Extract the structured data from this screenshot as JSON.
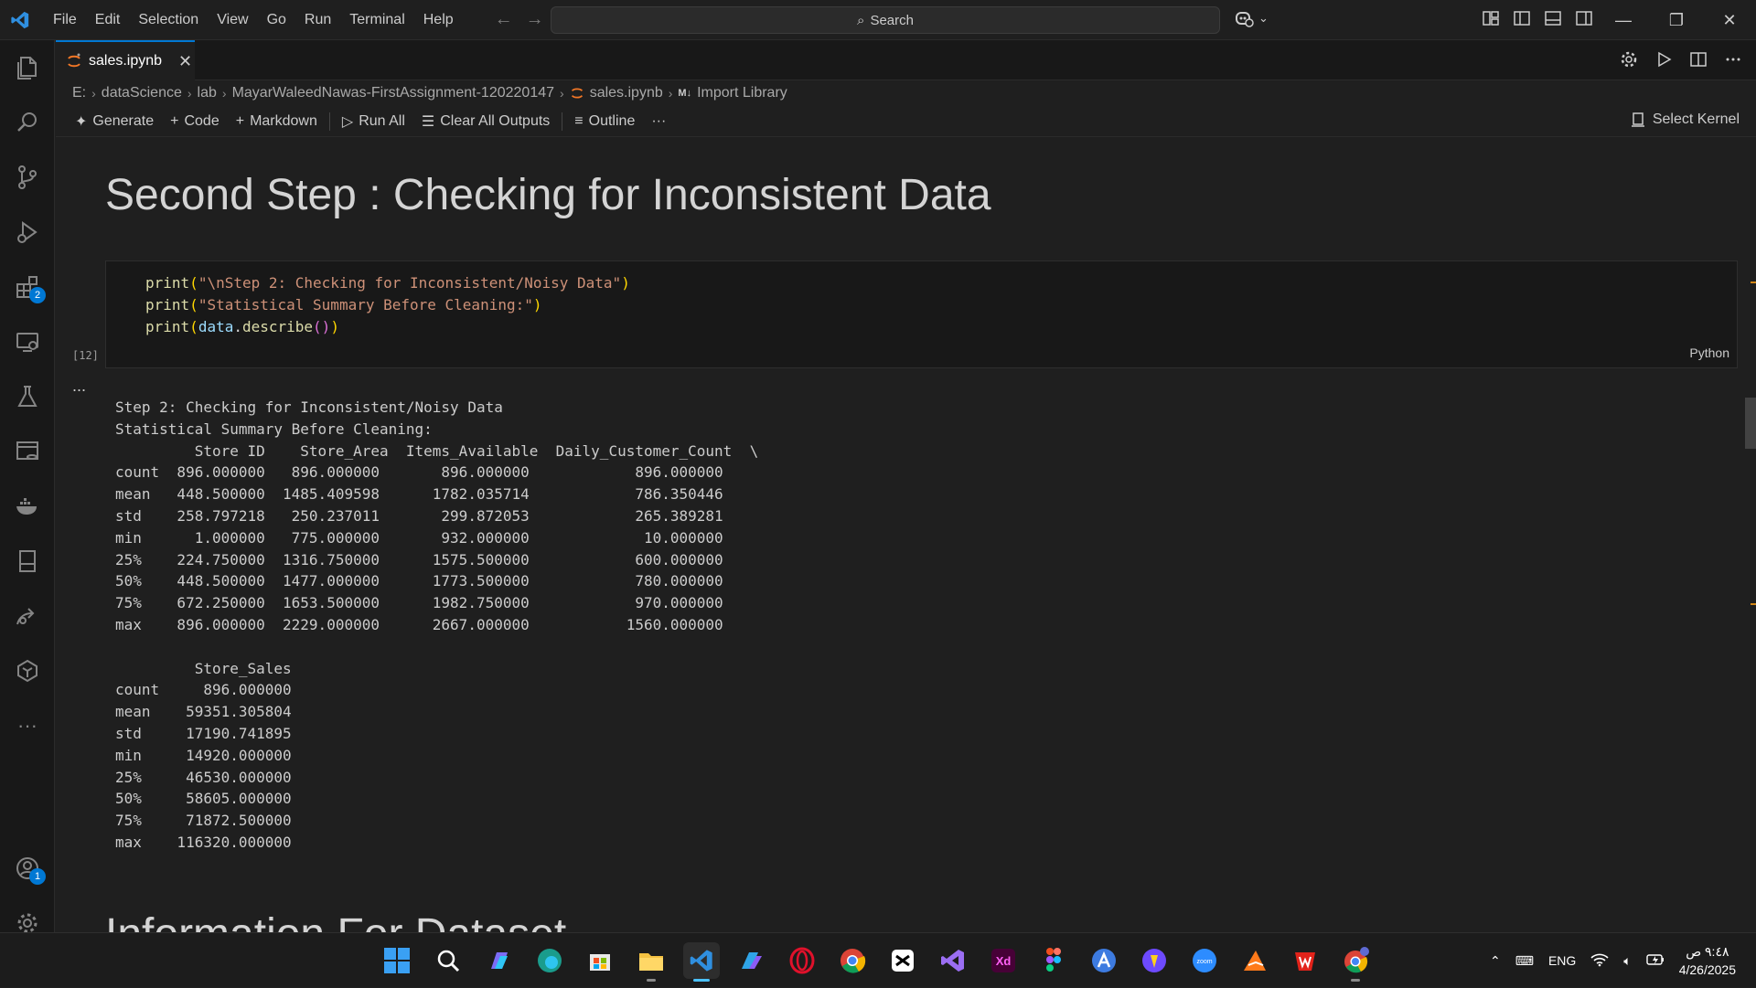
{
  "titlebar": {
    "menu": [
      "File",
      "Edit",
      "Selection",
      "View",
      "Go",
      "Run",
      "Terminal",
      "Help"
    ],
    "search_label": "Search"
  },
  "activity_badges": {
    "extensions": "2",
    "accounts": "1"
  },
  "tab": {
    "filename": "sales.ipynb"
  },
  "breadcrumb": [
    "E:",
    "dataScience",
    "lab",
    "MayarWaleedNawas-FirstAssignment-120220147",
    "sales.ipynb",
    "Import Library"
  ],
  "toolbar": {
    "generate": "Generate",
    "code": "Code",
    "markdown": "Markdown",
    "run_all": "Run All",
    "clear_outputs": "Clear All Outputs",
    "outline": "Outline",
    "more": "···",
    "kernel": "Select Kernel"
  },
  "notebook": {
    "heading": "Second Step : Checking for Inconsistent Data",
    "code": {
      "line1_fn": "print",
      "line1_str": "\"\\nStep 2: Checking for Inconsistent/Noisy Data\"",
      "line2_fn": "print",
      "line2_str": "\"Statistical Summary Before Cleaning:\"",
      "line3_fn": "print",
      "line3_var": "data",
      "line3_method": "describe",
      "exec_count": "[12]",
      "language": "Python"
    },
    "output_dots": "...",
    "output_text": "Step 2: Checking for Inconsistent/Noisy Data\nStatistical Summary Before Cleaning:\n         Store ID    Store_Area  Items_Available  Daily_Customer_Count  \\\ncount  896.000000   896.000000       896.000000            896.000000   \nmean   448.500000  1485.409598      1782.035714            786.350446   \nstd    258.797218   250.237011       299.872053            265.389281   \nmin      1.000000   775.000000       932.000000             10.000000   \n25%    224.750000  1316.750000      1575.500000            600.000000   \n50%    448.500000  1477.000000      1773.500000            780.000000   \n75%    672.250000  1653.500000      1982.750000            970.000000   \nmax    896.000000  2229.000000      2667.000000           1560.000000   \n\n         Store_Sales  \ncount     896.000000  \nmean    59351.305804  \nstd     17190.741895  \nmin     14920.000000  \n25%     46530.000000  \n50%     58605.000000  \n75%     71872.500000  \nmax    116320.000000  ",
    "next_heading": "Information For Dataset"
  },
  "taskbar": {
    "apps": [
      "start-button",
      "search",
      "copilot",
      "edge",
      "store",
      "file-explorer",
      "vscode",
      "m365",
      "opera",
      "chrome",
      "capcut",
      "visual-studio",
      "adobe-xd",
      "figma",
      "app-a",
      "proton",
      "zoom",
      "sublime",
      "wps",
      "chrome-profile"
    ],
    "lang": "ENG",
    "time": "٩:٤٨ ص",
    "date": "4/26/2025"
  }
}
